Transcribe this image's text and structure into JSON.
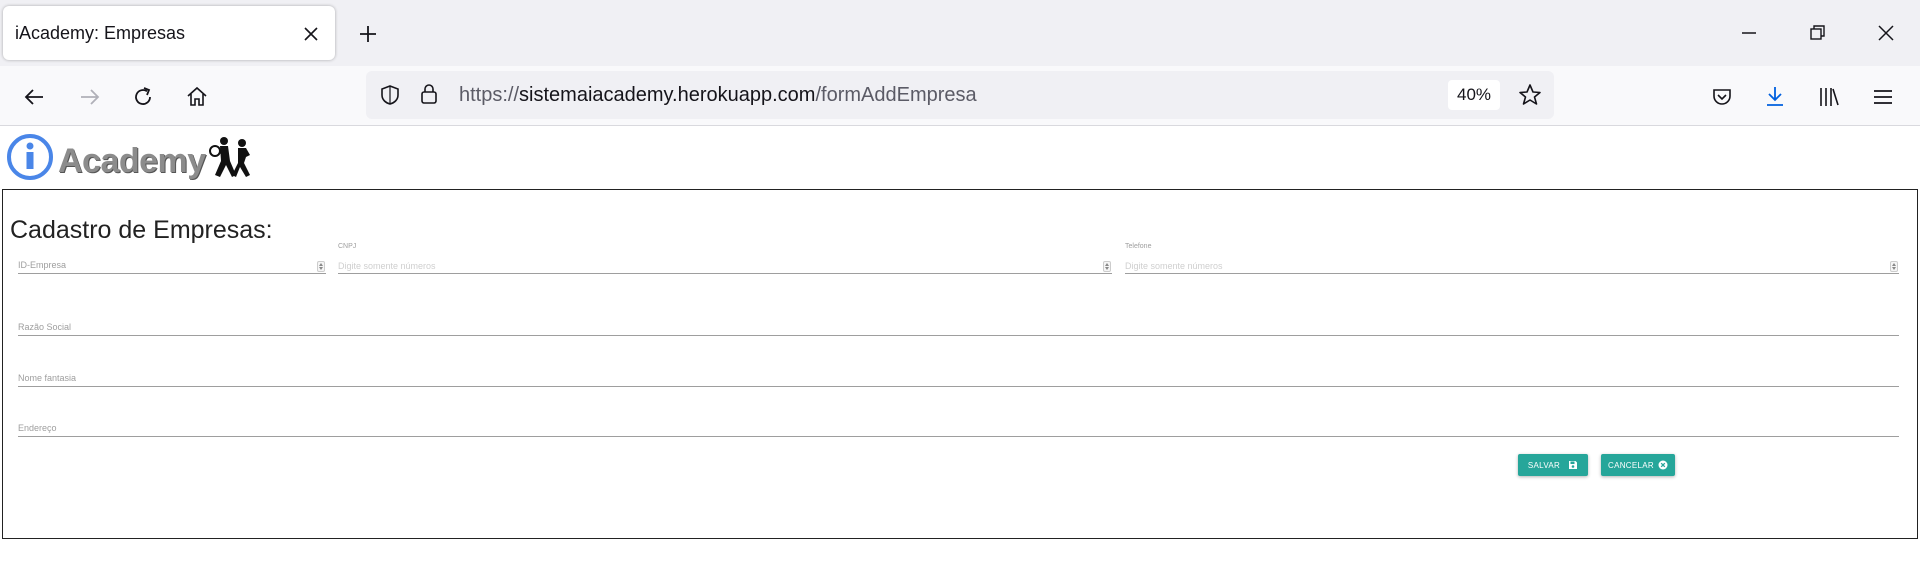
{
  "browser": {
    "tab_title": "iAcademy: Empresas",
    "url_prefix": "https://",
    "url_host": "sistemaiacademy.herokuapp.com",
    "url_path": "/formAddEmpresa",
    "zoom": "40%"
  },
  "logo": {
    "text": "Academy"
  },
  "form": {
    "title": "Cadastro de Empresas:",
    "fields": {
      "id_empresa": {
        "label": "ID-Empresa"
      },
      "cnpj": {
        "label": "CNPJ",
        "placeholder": "Digite somente números"
      },
      "telefone": {
        "label": "Telefone",
        "placeholder": "Digite somente números"
      },
      "razao_social": {
        "label": "Razão Social"
      },
      "nome_fantasia": {
        "label": "Nome fantasia"
      },
      "endereco": {
        "label": "Endereço"
      }
    },
    "buttons": {
      "save": "SALVAR",
      "cancel": "CANCELAR"
    }
  },
  "colors": {
    "accent": "#26a69a",
    "logo_blue": "#4a86e8",
    "logo_gray": "#8c8c8c"
  }
}
